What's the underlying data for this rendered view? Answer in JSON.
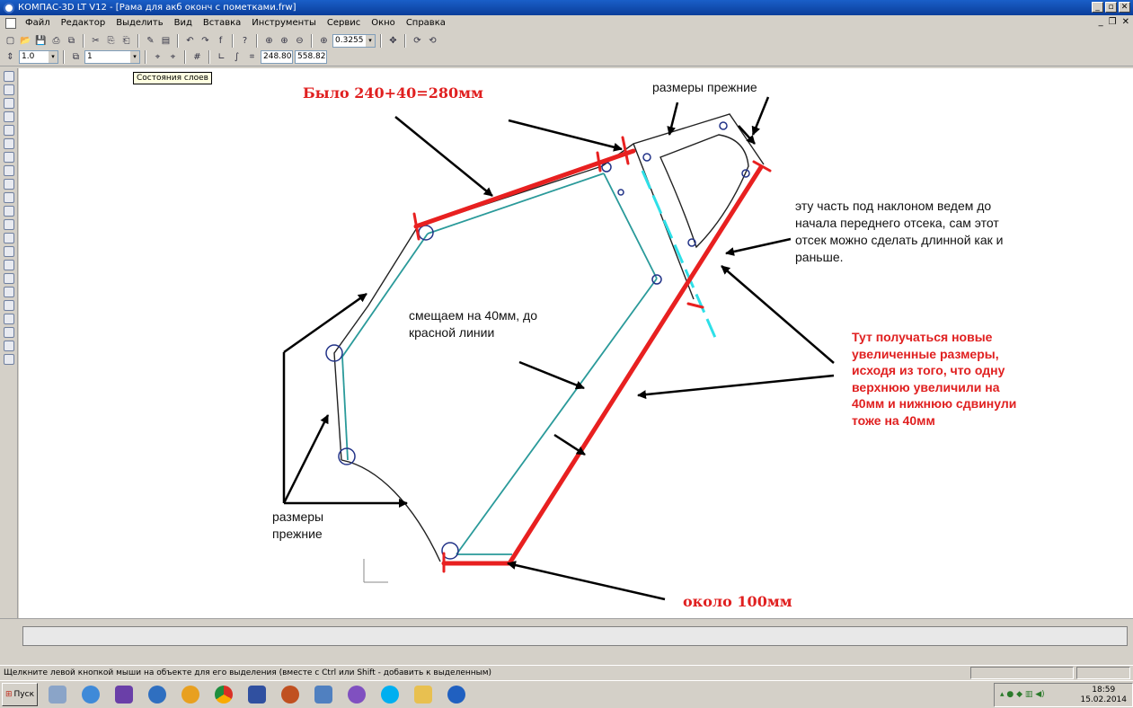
{
  "window": {
    "title": "КОМПАС-3D LT V12 - [Рама для акб оконч с пометками.frw]"
  },
  "menu": [
    "Файл",
    "Редактор",
    "Выделить",
    "Вид",
    "Вставка",
    "Инструменты",
    "Сервис",
    "Окно",
    "Справка"
  ],
  "toolbar": {
    "zoom": "0.3255",
    "line_scale": "1.0",
    "layer": "1",
    "coord_x": "248.80",
    "coord_y": "558.82"
  },
  "tooltip": "Состояния слоев",
  "annotations": {
    "was": "Было 240+40=280мм",
    "dims_top": "размеры прежние",
    "slope_note": "эту часть под наклоном ведем до\nначала переднего отсека, сам этот\nотсек можно сделать длинной как и\nраньше.",
    "shift_note": "смещаем на 40мм, до\nкрасной линии",
    "new_dims": "Тут получаться новые\nувеличенные размеры,\nисходя из того, что одну\nверхнюю увеличили на\n40мм и нижнюю сдвинули\nтоже на 40мм",
    "dims_left": "размеры\nпрежние",
    "about": "около 100мм"
  },
  "status": {
    "hint": "Щелкните левой кнопкой мыши на объекте для его выделения (вместе с Ctrl или Shift - добавить к выделенным)"
  },
  "taskbar": {
    "start": "Пуск",
    "time": "18:59",
    "date": "15.02.2014"
  },
  "colors": {
    "titlebar": "#0a3d9a",
    "red_line": "#e82020",
    "teal_line": "#2a9a9a",
    "cyan_dash": "#2ee0e8"
  }
}
